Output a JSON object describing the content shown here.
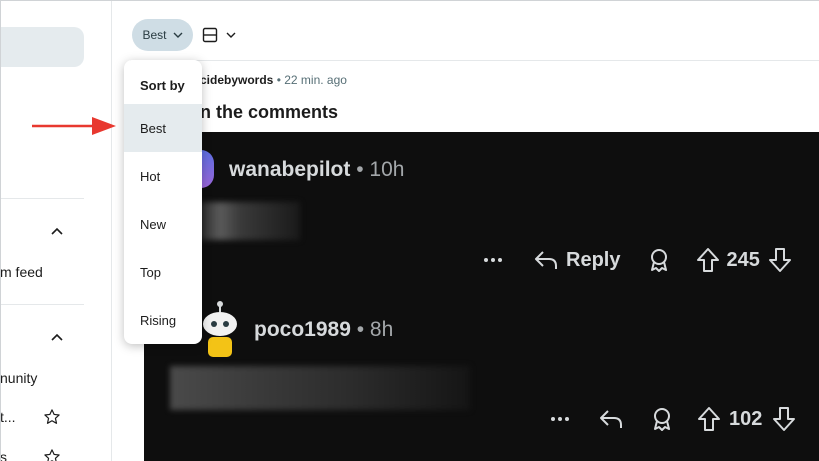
{
  "sidebar": {
    "items": [
      {
        "label": "m feed"
      },
      {
        "label": "nunity"
      },
      {
        "label": "t..."
      },
      {
        "label": "s"
      }
    ]
  },
  "toolbar": {
    "sort_label": "Best"
  },
  "post": {
    "author": "cidebywords",
    "time": "• 22 min. ago",
    "title": "n the comments"
  },
  "comments": [
    {
      "user": "wanabepilot",
      "time": "• 10h",
      "reply_label": "Reply",
      "votes": "245"
    },
    {
      "user": "poco1989",
      "time": "• 8h",
      "votes": "102"
    }
  ],
  "sort_menu": {
    "header": "Sort by",
    "options": [
      "Best",
      "Hot",
      "New",
      "Top",
      "Rising"
    ],
    "selected": "Best"
  },
  "colors": {
    "arrow": "#e8382f",
    "selected_bg": "#e5ebee",
    "sort_button_bg": "#cfdde5",
    "dark_bg": "#0e0e0e"
  }
}
